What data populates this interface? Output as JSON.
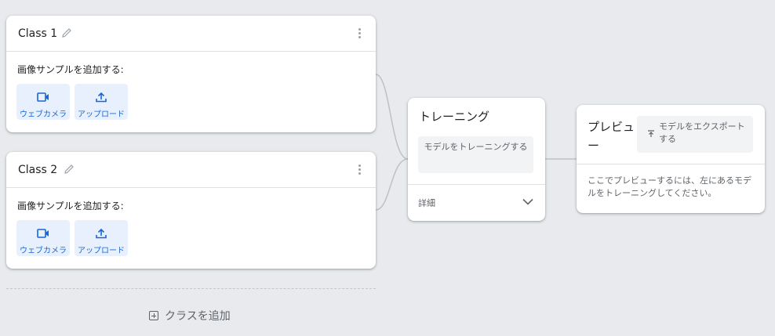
{
  "classes": [
    {
      "title": "Class 1",
      "add_label": "画像サンプルを追加する:",
      "webcam_label": "ウェブカメラ",
      "upload_label": "アップロード"
    },
    {
      "title": "Class 2",
      "add_label": "画像サンプルを追加する:",
      "webcam_label": "ウェブカメラ",
      "upload_label": "アップロード"
    }
  ],
  "add_class_label": "クラスを追加",
  "training": {
    "title": "トレーニング",
    "train_button": "モデルをトレーニングする",
    "details_label": "詳細"
  },
  "preview": {
    "title": "プレビュー",
    "export_button": "モデルをエクスポートする",
    "message": "ここでプレビューするには、左にあるモデルをトレーニングしてください。"
  },
  "colors": {
    "background": "#e8eaed",
    "accent": "#1967d2",
    "button_tint": "#e8f0fe"
  }
}
